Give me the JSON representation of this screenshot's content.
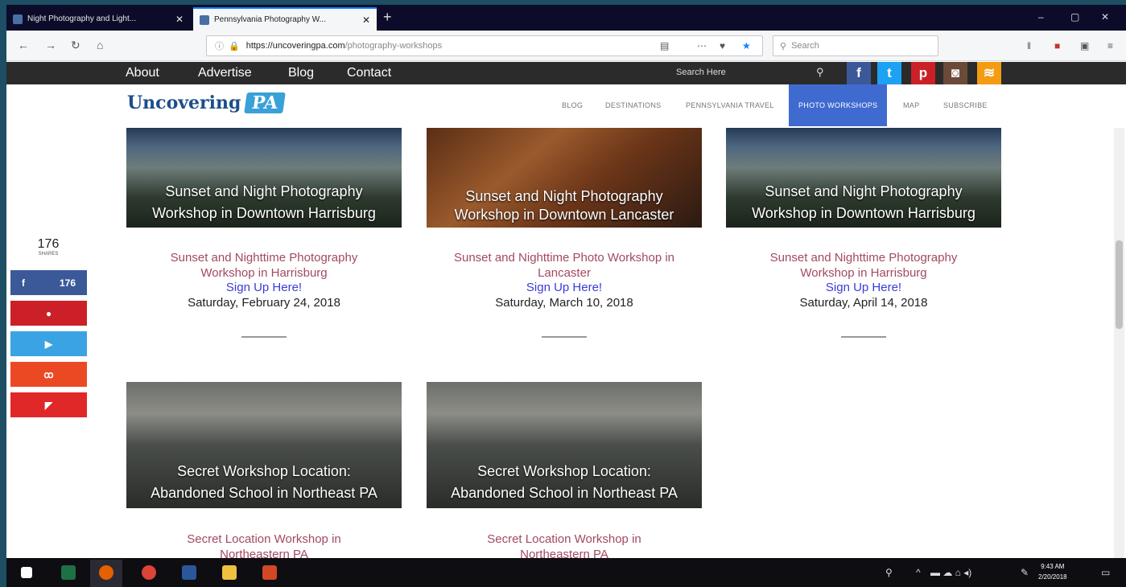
{
  "browser": {
    "tabs": [
      {
        "title": "Night Photography and Light..."
      },
      {
        "title": "Pennsylvania Photography W..."
      }
    ],
    "new_tab_symbol": "+",
    "url_host": "https://uncoveringpa.com",
    "url_path": "/photography-workshops",
    "search_placeholder": "Search",
    "window_controls": {
      "minimize": "–",
      "maximize": "▢",
      "close": "✕"
    }
  },
  "site_topbar": {
    "links": [
      "About",
      "Advertise",
      "Blog",
      "Contact"
    ],
    "search_text": "Search Here",
    "social": [
      "facebook-icon",
      "twitter-icon",
      "pinterest-icon",
      "instagram-icon",
      "rss-icon"
    ]
  },
  "site_header": {
    "logo_text": "Uncovering",
    "logo_badge": "PA",
    "nav": [
      "BLOG",
      "DESTINATIONS",
      "PENNSYLVANIA TRAVEL",
      "PHOTO WORKSHOPS",
      "MAP",
      "SUBSCRIBE"
    ],
    "active_nav": "PHOTO WORKSHOPS"
  },
  "share": {
    "count": "176",
    "label": "SHARES",
    "facebook_count": "176",
    "colors": {
      "facebook": "#3b5998",
      "pinterest": "#cb2027",
      "twitter": "#3aa3e3",
      "stumbleupon": "#eb4924",
      "flipboard": "#e12828"
    }
  },
  "workshops": [
    {
      "image_caption_line1": "Sunset and Night Photography",
      "image_caption_line2": "Workshop in Downtown Harrisburg",
      "title_line1": "Sunset and Nighttime Photography",
      "title_line2": "Workshop in Harrisburg",
      "signup": "Sign Up Here!",
      "date": "Saturday, February 24, 2018"
    },
    {
      "image_caption_line1": "Sunset and Night Photography",
      "image_caption_line2": "Workshop in Downtown Lancaster",
      "title_line1": "Sunset and Nighttime Photo Workshop in",
      "title_line2": "Lancaster",
      "signup": "Sign Up Here!",
      "date": "Saturday, March 10, 2018"
    },
    {
      "image_caption_line1": "Sunset and Night Photography",
      "image_caption_line2": "Workshop in Downtown Harrisburg",
      "title_line1": "Sunset and Nighttime Photography",
      "title_line2": "Workshop in Harrisburg",
      "signup": "Sign Up Here!",
      "date": "Saturday, April 14, 2018"
    },
    {
      "image_caption_line1": "Secret Workshop Location:",
      "image_caption_line2": "Abandoned School in Northeast PA",
      "title_line1": "Secret Location Workshop in",
      "title_line2": "Northeastern PA"
    },
    {
      "image_caption_line1": "Secret Workshop Location:",
      "image_caption_line2": "Abandoned School in Northeast PA",
      "title_line1": "Secret Location Workshop in",
      "title_line2": "Northeastern PA"
    }
  ],
  "taskbar": {
    "time": "9:43 AM",
    "date": "2/20/2018",
    "apps": [
      "windows-start-icon",
      "excel-icon",
      "firefox-icon",
      "chrome-icon",
      "word-icon",
      "file-explorer-icon",
      "powerpoint-icon"
    ]
  }
}
